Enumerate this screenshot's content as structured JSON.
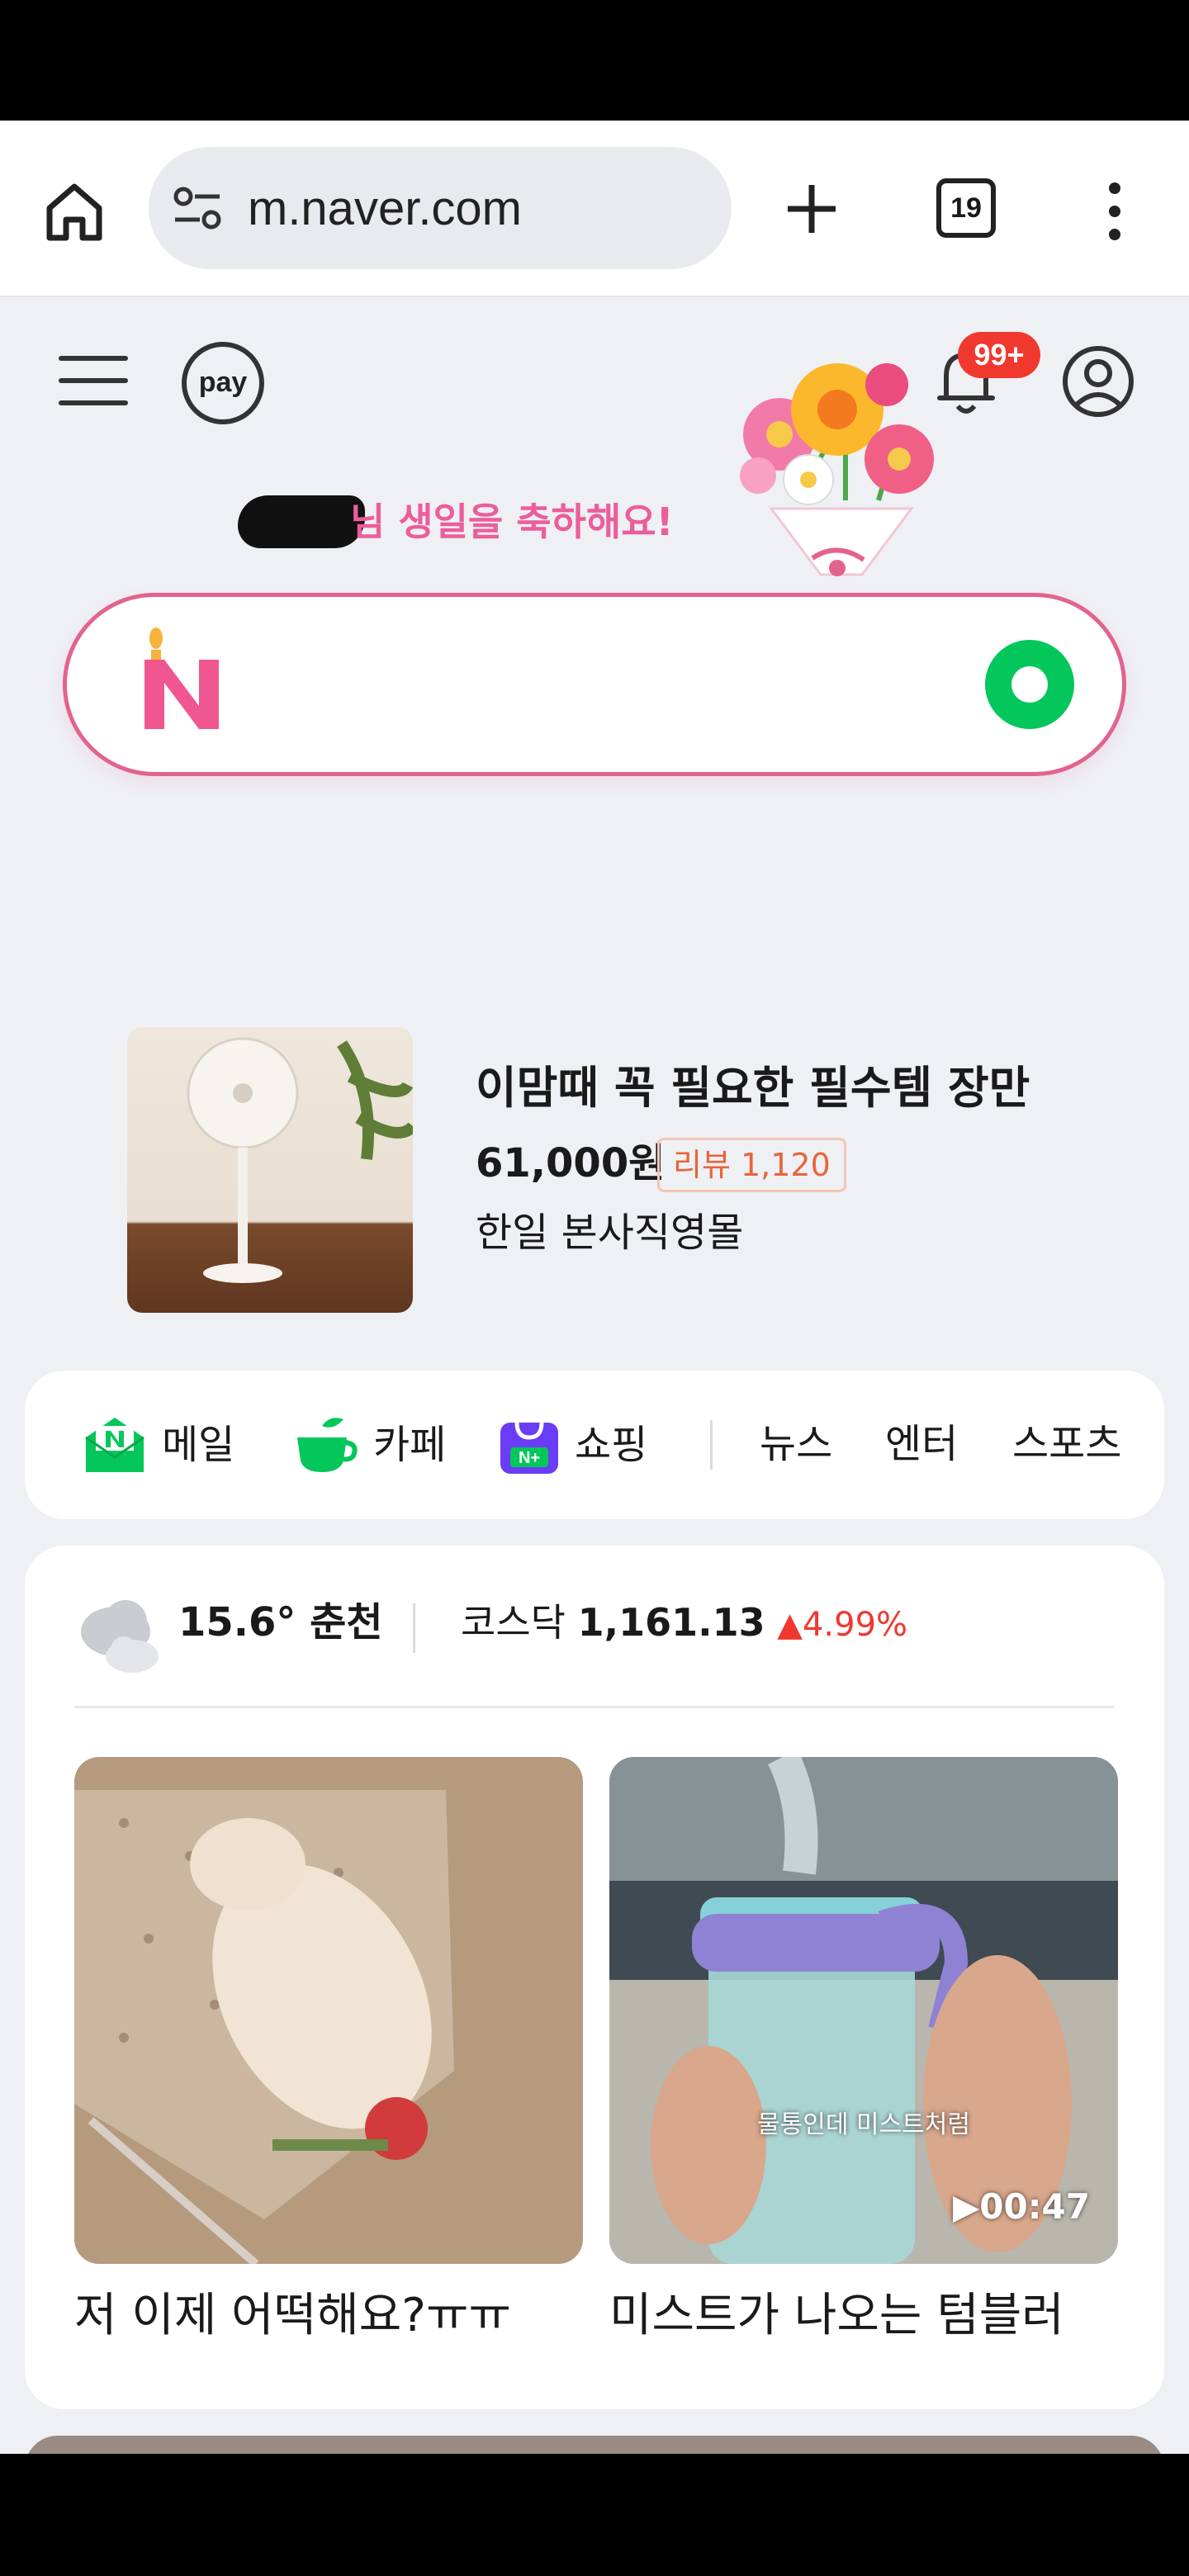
{
  "browser": {
    "url": "m.naver.com",
    "tab_count": "19"
  },
  "header": {
    "pay_label": "pay",
    "notification_count": "99+",
    "birthday_message": "님 생일을 축하해요!"
  },
  "ad": {
    "title": "이맘때 꼭 필요한 필수템 장만",
    "price": "61,000원",
    "review": "리뷰 1,120",
    "seller": "한일 본사직영몰"
  },
  "shortcuts": {
    "mail": "메일",
    "cafe": "카페",
    "shopping": "쇼핑",
    "news": "뉴스",
    "enter": "엔터",
    "sports": "스포츠"
  },
  "weather": {
    "temp": "15.6°",
    "city": "춘천"
  },
  "stock": {
    "name": "코스닥",
    "value": "1,161.13",
    "change": "4.99%"
  },
  "feed": {
    "cards": [
      {
        "title": "저 이제 어떡해요?ㅠㅠ"
      },
      {
        "title": "미스트가 나오는 텀블러",
        "caption": "물통인데 미스트처럼",
        "duration": "00:47"
      }
    ]
  },
  "colors": {
    "naver_green": "#03c75a",
    "birthday_pink": "#ec5d9a",
    "badge_red": "#f0382f"
  }
}
